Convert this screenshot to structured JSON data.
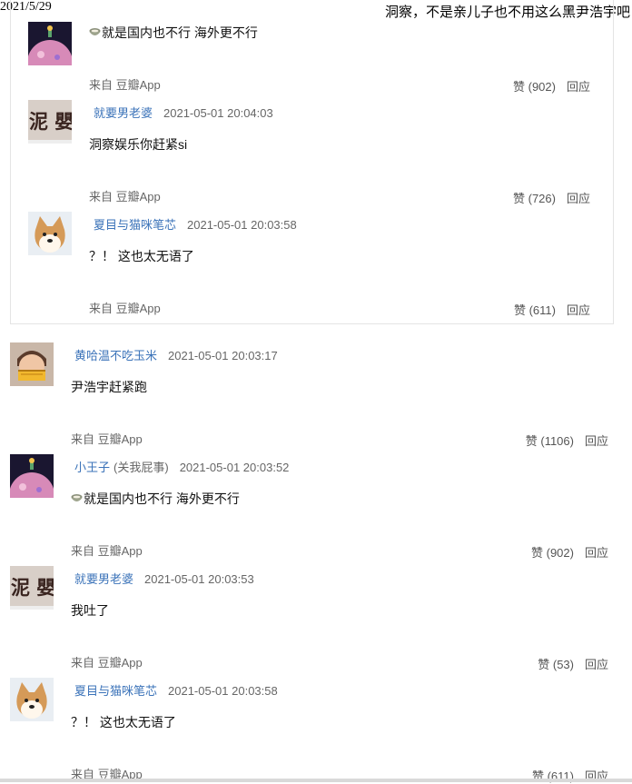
{
  "print_header": {
    "date": "2021/5/29",
    "title": "洞察，不是亲儿子也不用这么黑尹浩宇吧"
  },
  "labels": {
    "source": "来自 豆瓣App",
    "reply": "回应"
  },
  "nested": [
    {
      "content": "就是国内也不行 海外更不行",
      "likes": "赞 (902)",
      "emoji": "bowl-emoji"
    },
    {
      "author": "就要男老婆",
      "time": "2021-05-01 20:04:03",
      "content": "洞察娱乐你赶紧si",
      "likes": "赞 (726)",
      "avatar": "text-avatar"
    },
    {
      "author": "夏目与猫咪笔芯",
      "time": "2021-05-01 20:03:58",
      "content": "？！ 这也太无语了",
      "likes": "赞 (611)",
      "avatar": "dog-avatar"
    }
  ],
  "comments": [
    {
      "author": "黄哈温不吃玉米",
      "time": "2021-05-01 20:03:17",
      "content": "尹浩宇赶紧跑",
      "likes": "赞 (1106)",
      "avatar": "child-avatar"
    },
    {
      "author": "小王子",
      "tag": "(关我屁事)",
      "time": "2021-05-01 20:03:52",
      "content": "就是国内也不行 海外更不行",
      "likes": "赞 (902)",
      "avatar": "pink-planet-avatar",
      "emoji": "bowl-emoji"
    },
    {
      "author": "就要男老婆",
      "time": "2021-05-01 20:03:53",
      "content": "我吐了",
      "likes": "赞 (53)",
      "avatar": "text-avatar"
    },
    {
      "author": "夏目与猫咪笔芯",
      "time": "2021-05-01 20:03:58",
      "content": "？！ 这也太无语了",
      "likes": "赞 (611)",
      "avatar": "dog-avatar"
    }
  ],
  "avatar_text": "泥 嬰"
}
